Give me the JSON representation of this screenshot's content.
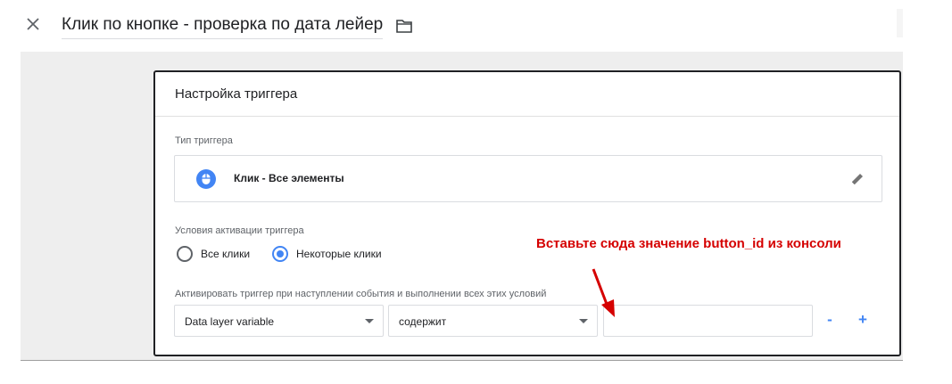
{
  "header": {
    "title": "Клик по кнопке - проверка по дата лейер"
  },
  "card": {
    "title": "Настройка триггера",
    "trigger_type": {
      "label": "Тип триггера",
      "value": "Клик - Все элементы"
    },
    "activation": {
      "label": "Условия активации триггера",
      "options": [
        {
          "label": "Все клики",
          "checked": false
        },
        {
          "label": "Некоторые клики",
          "checked": true
        }
      ]
    },
    "condition": {
      "label": "Активировать триггер при наступлении события и выполнении всех этих условий",
      "variable": "Data layer variable",
      "operator": "содержит",
      "value": "",
      "remove_label": "-",
      "add_label": "+"
    }
  },
  "annotation": {
    "text": "Вставьте сюда значение button_id из консоли",
    "color": "#d50000"
  },
  "colors": {
    "accent": "#4285f4",
    "background": "#eeeeee"
  }
}
